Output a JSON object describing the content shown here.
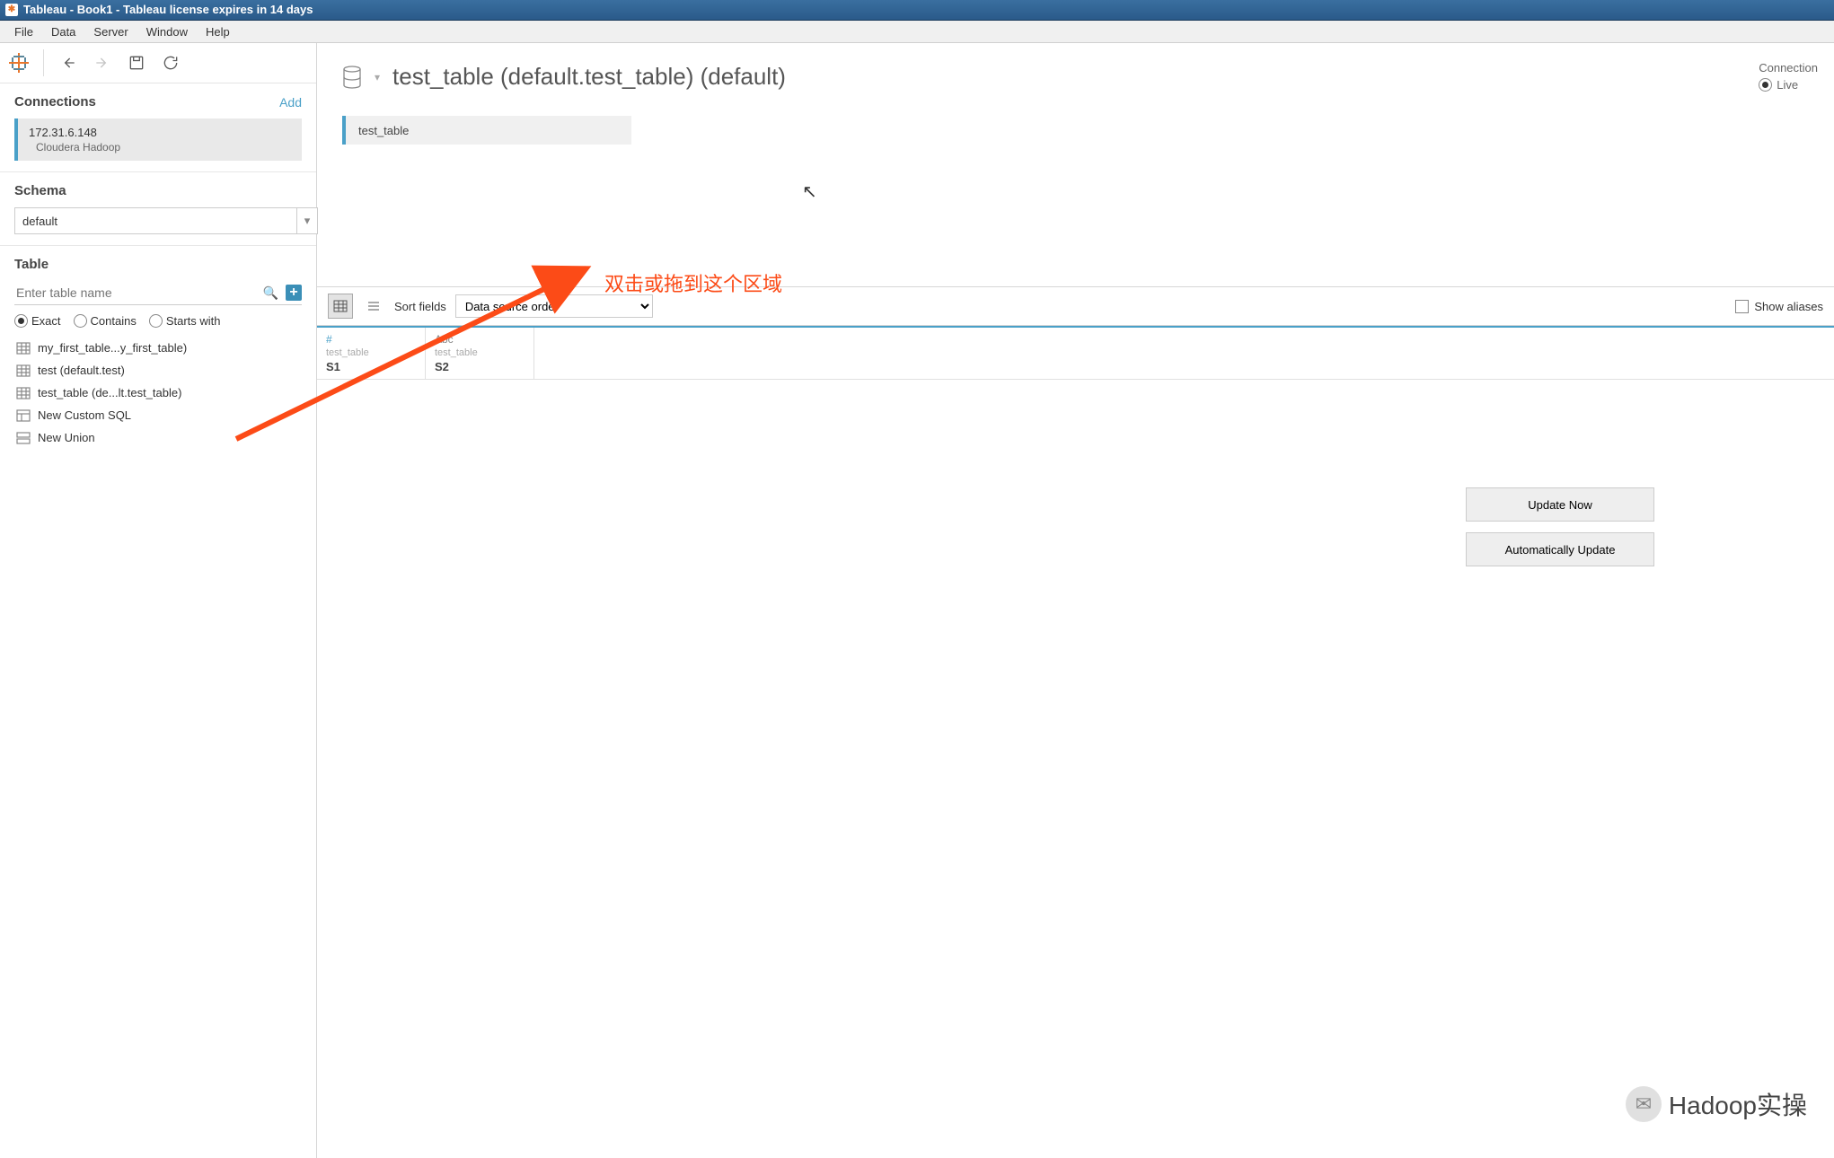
{
  "window": {
    "title": "Tableau - Book1 - Tableau license expires in 14 days"
  },
  "menu": {
    "items": [
      "File",
      "Data",
      "Server",
      "Window",
      "Help"
    ]
  },
  "sidebar": {
    "connections_label": "Connections",
    "add_label": "Add",
    "connection": {
      "host": "172.31.6.148",
      "type": "Cloudera Hadoop"
    },
    "schema_label": "Schema",
    "schema_value": "default",
    "table_label": "Table",
    "table_placeholder": "Enter table name",
    "match": {
      "exact": "Exact",
      "contains": "Contains",
      "starts": "Starts with"
    },
    "tables": [
      "my_first_table...y_first_table)",
      "test (default.test)",
      "test_table (de...lt.test_table)",
      "New Custom SQL",
      "New Union"
    ]
  },
  "main": {
    "datasource_title": "test_table (default.test_table) (default)",
    "connection_label": "Connection",
    "connection_mode": "Live",
    "table_pill": "test_table",
    "annotation_text": "双击或拖到这个区域",
    "sort_label": "Sort fields",
    "sort_value": "Data source order",
    "show_aliases": "Show aliases",
    "columns": [
      {
        "type": "#",
        "type_class": "num",
        "table": "test_table",
        "field": "S1"
      },
      {
        "type": "Abc",
        "type_class": "",
        "table": "test_table",
        "field": "S2"
      }
    ],
    "update_now": "Update Now",
    "auto_update": "Automatically Update",
    "watermark": "Hadoop实操"
  }
}
